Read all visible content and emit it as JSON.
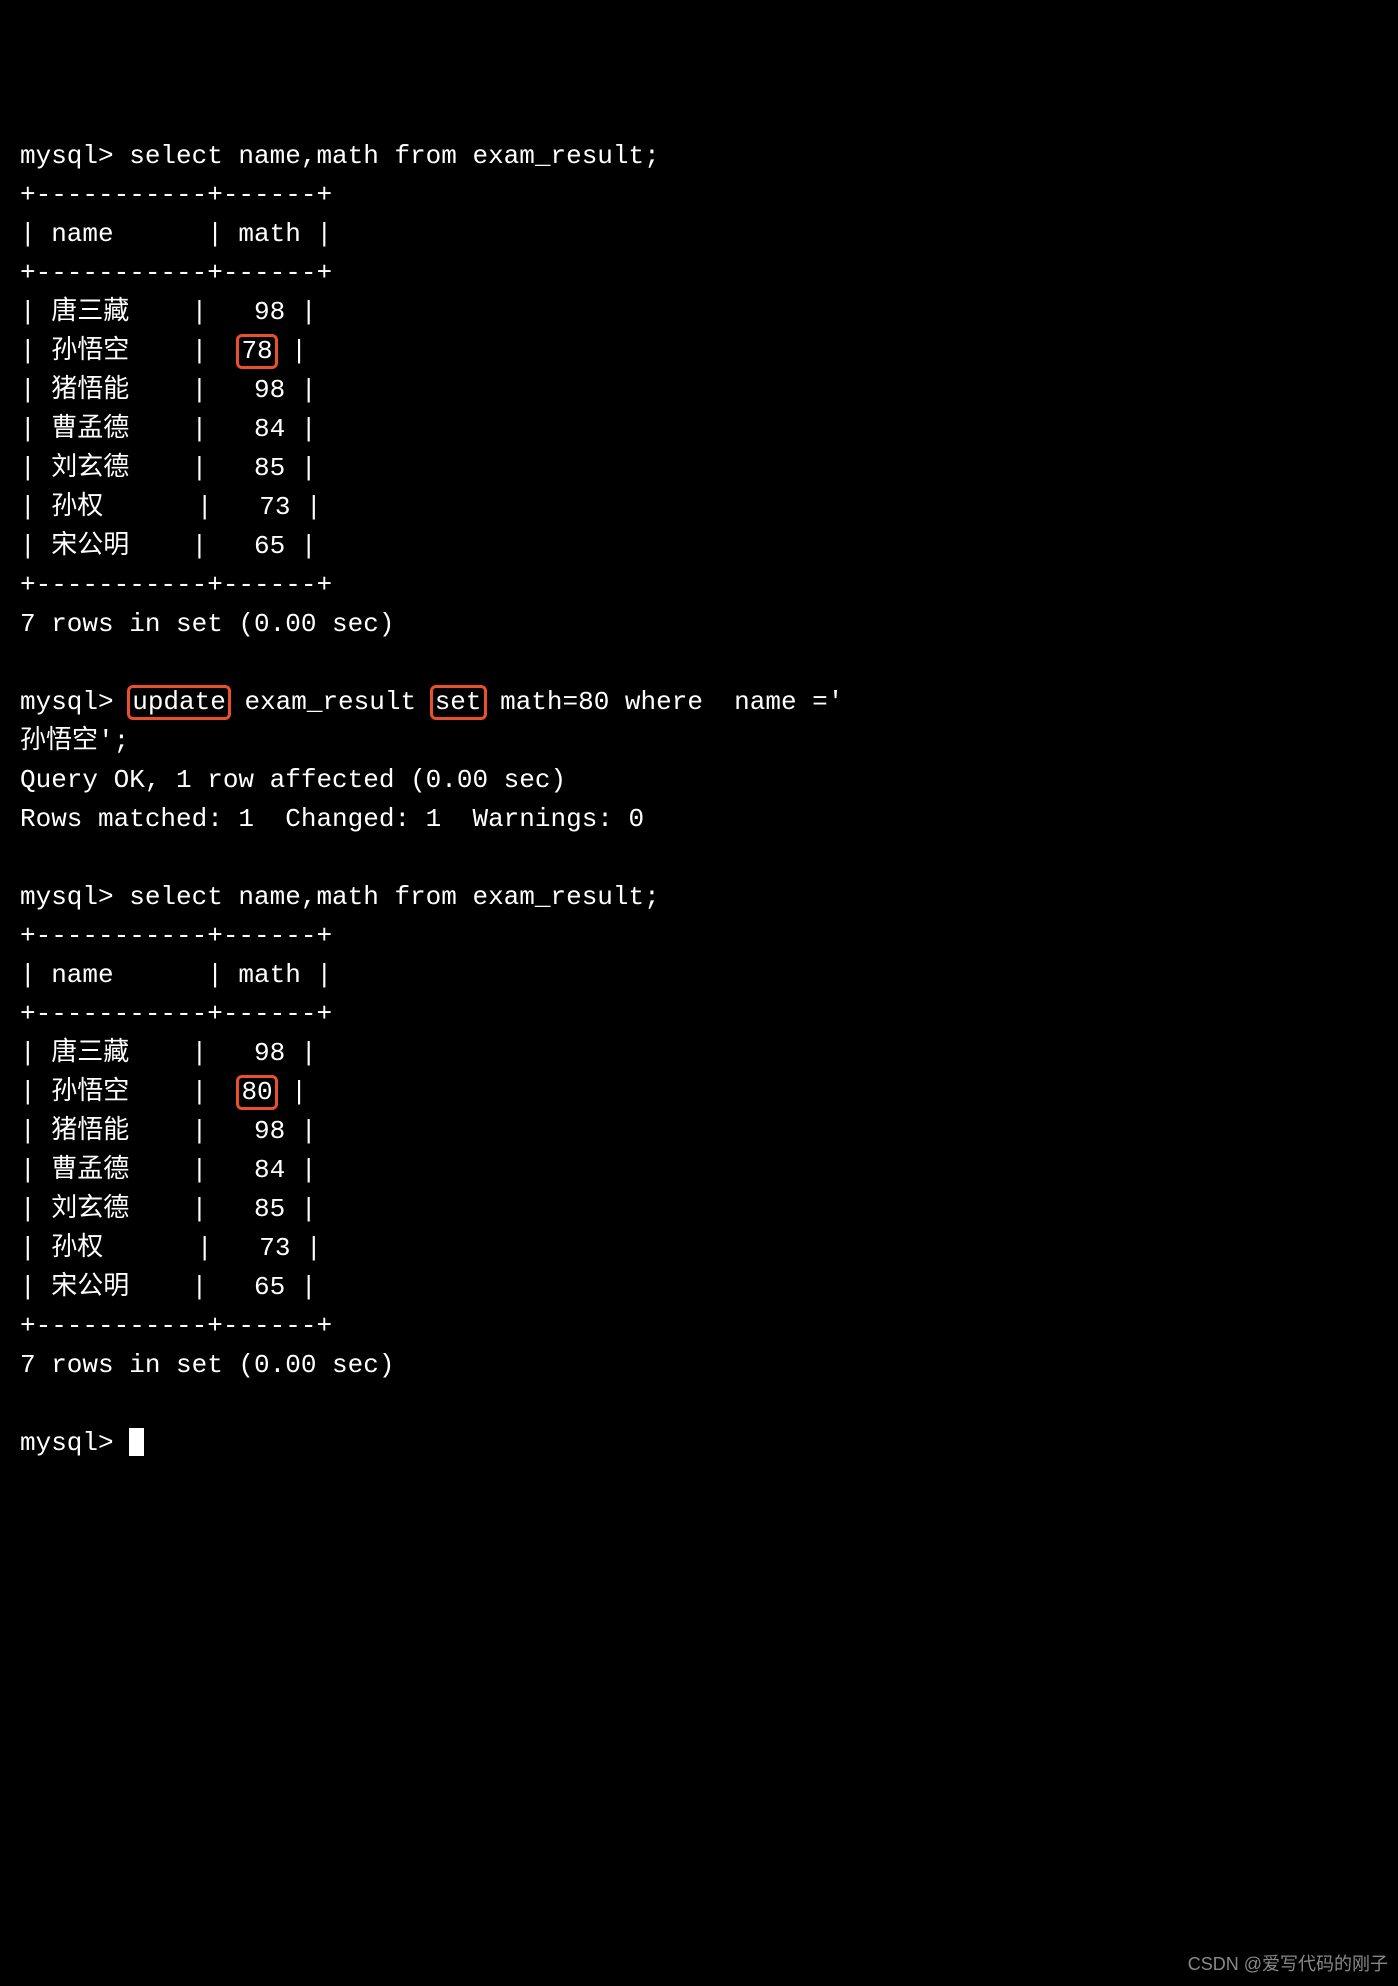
{
  "prompt": "mysql> ",
  "query1": "select name,math from exam_result;",
  "table_border": "+-----------+------+",
  "header_row": "| name      | math |",
  "rows1": [
    {
      "name": "唐三藏",
      "math": "98",
      "hl": false
    },
    {
      "name": "孙悟空",
      "math": "78",
      "hl": true
    },
    {
      "name": "猪悟能",
      "math": "98",
      "hl": false
    },
    {
      "name": "曹孟德",
      "math": "84",
      "hl": false
    },
    {
      "name": "刘玄德",
      "math": "85",
      "hl": false
    },
    {
      "name": "孙权",
      "math": "73",
      "hl": false
    },
    {
      "name": "宋公明",
      "math": "65",
      "hl": false
    }
  ],
  "summary1": "7 rows in set (0.00 sec)",
  "update_parts": {
    "kw1": "update",
    "mid": " exam_result ",
    "kw2": "set",
    "rest1": " math=80 where  name ='",
    "rest2": "孙悟空';"
  },
  "update_ok": "Query OK, 1 row affected (0.00 sec)",
  "update_rows": "Rows matched: 1  Changed: 1  Warnings: 0",
  "rows2": [
    {
      "name": "唐三藏",
      "math": "98",
      "hl": false
    },
    {
      "name": "孙悟空",
      "math": "80",
      "hl": true
    },
    {
      "name": "猪悟能",
      "math": "98",
      "hl": false
    },
    {
      "name": "曹孟德",
      "math": "84",
      "hl": false
    },
    {
      "name": "刘玄德",
      "math": "85",
      "hl": false
    },
    {
      "name": "孙权",
      "math": "73",
      "hl": false
    },
    {
      "name": "宋公明",
      "math": "65",
      "hl": false
    }
  ],
  "watermark": "CSDN @爱写代码的刚子"
}
